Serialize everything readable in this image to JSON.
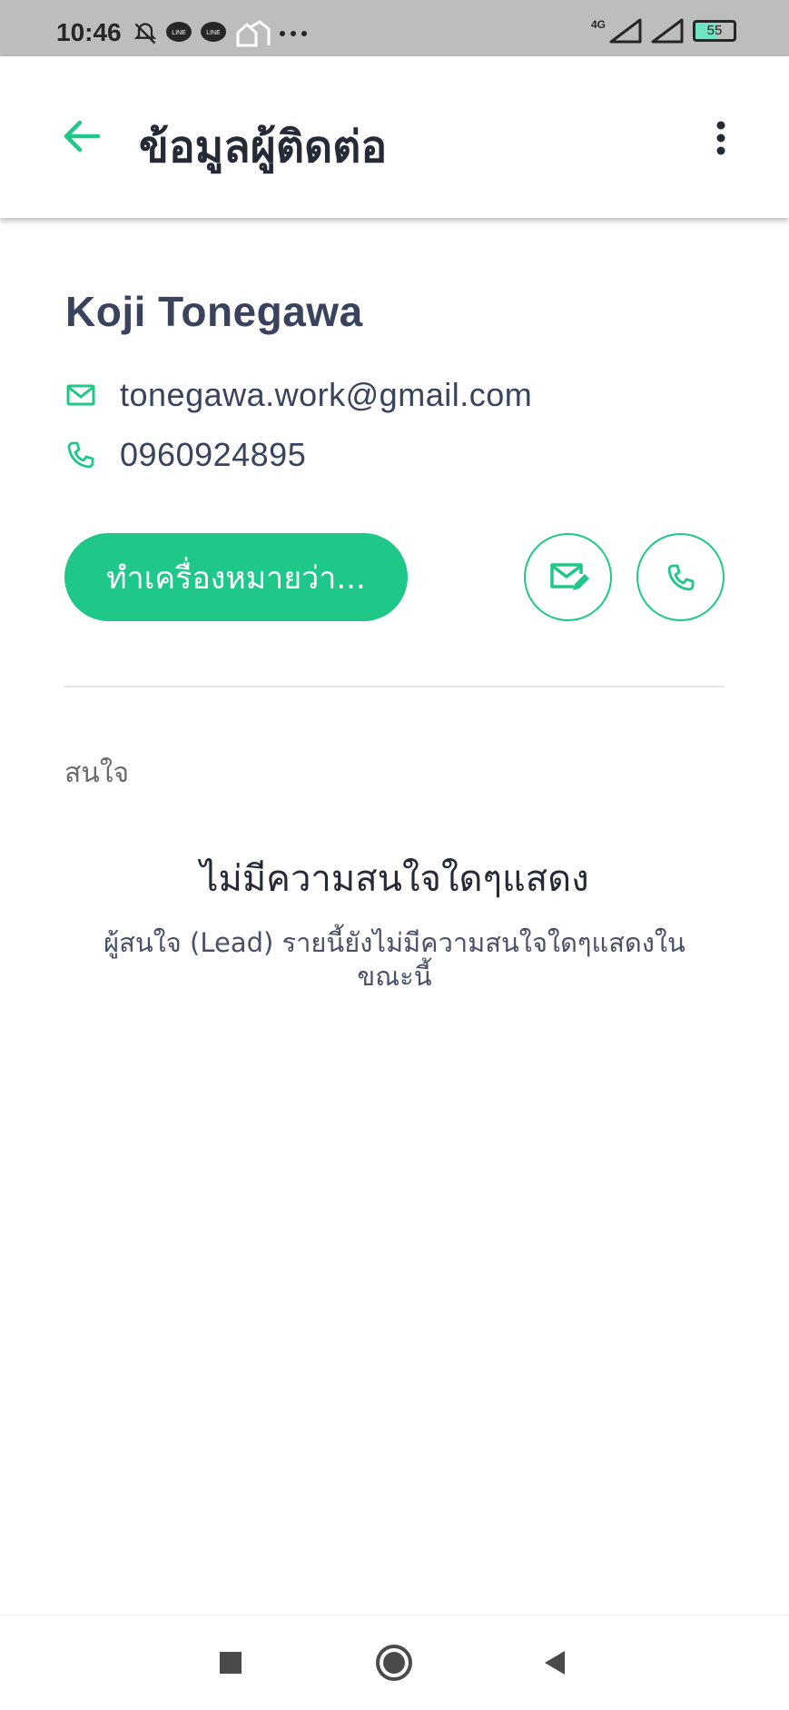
{
  "status_bar": {
    "time": "10:46",
    "left_icons": [
      "bell-off-icon",
      "line-app-icon",
      "line-app-icon",
      "home-app-icon",
      "more-dots-icon"
    ],
    "network_label": "4G",
    "battery_level": "55"
  },
  "app_bar": {
    "title": "ข้อมูลผู้ติดต่อ"
  },
  "contact": {
    "name": "Koji Tonegawa",
    "email": "tonegawa.work@gmail.com",
    "phone": "0960924895"
  },
  "actions": {
    "mark_as_label": "ทำเครื่องหมายว่า..."
  },
  "interests": {
    "section_label": "สนใจ",
    "empty_title": "ไม่มีความสนใจใดๆแสดง",
    "empty_description": "ผู้สนใจ (Lead) รายนี้ยังไม่มีความสนใจใดๆแสดงใน ขณะนี้"
  },
  "colors": {
    "accent": "#1fc788",
    "text_dark": "#39435e",
    "status_bar_bg": "#bdbdbd"
  }
}
